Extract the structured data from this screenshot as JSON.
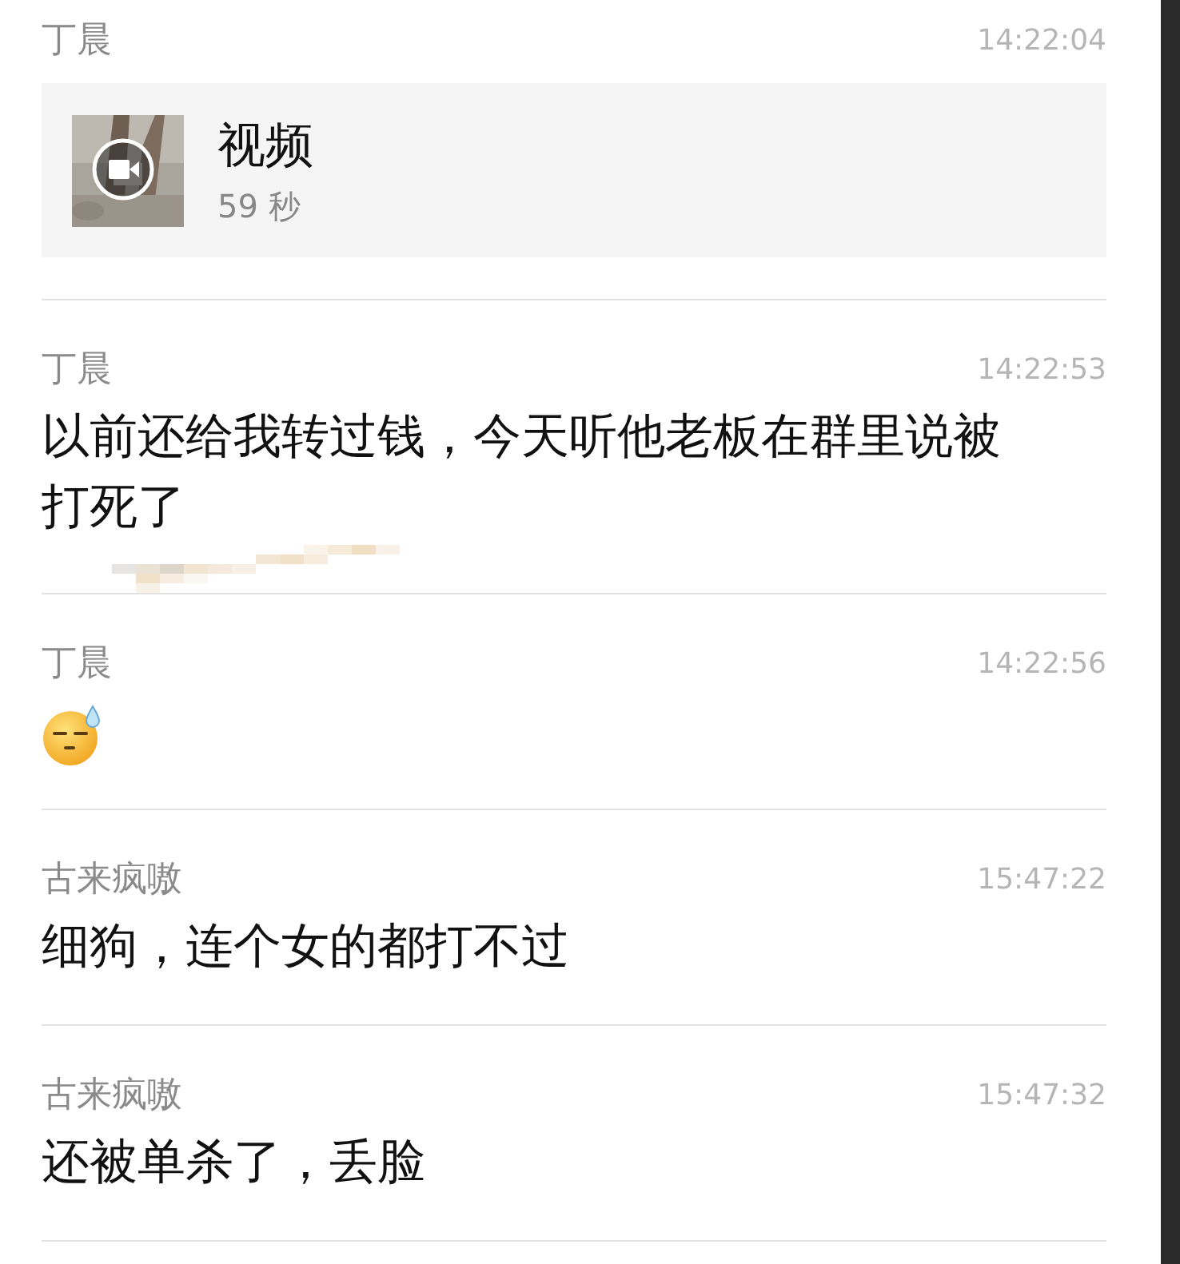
{
  "messages": [
    {
      "sender": "丁晨",
      "time": "14:22:04",
      "kind": "video",
      "title": "视频",
      "duration": "59 秒"
    },
    {
      "sender": "丁晨",
      "time": "14:22:53",
      "kind": "text",
      "text": "以前还给我转过钱，今天听他老板在群里说被打死了",
      "redacted": true
    },
    {
      "sender": "丁晨",
      "time": "14:22:56",
      "kind": "emoji"
    },
    {
      "sender": "古来疯嗷",
      "time": "15:47:22",
      "kind": "text",
      "text": "细狗，连个女的都打不过",
      "redacted": false
    },
    {
      "sender": "古来疯嗷",
      "time": "15:47:32",
      "kind": "text",
      "text": "还被单杀了，丢脸",
      "redacted": false
    }
  ]
}
